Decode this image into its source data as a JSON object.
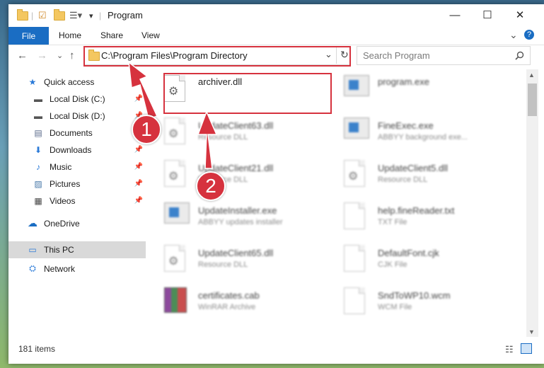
{
  "window": {
    "title": "Program",
    "controls": {
      "minimize": "—",
      "maximize": "☐",
      "close": "✕"
    }
  },
  "ribbon": {
    "tabs": [
      "File",
      "Home",
      "Share",
      "View"
    ],
    "expand": "⌄",
    "help": "?"
  },
  "nav": {
    "back": "←",
    "forward": "→",
    "recent": "⌄",
    "up": "↑",
    "address": "C:\\Program Files\\Program Directory",
    "address_dropdown": "⌄",
    "refresh": "↻",
    "search_placeholder": "Search Program",
    "search_icon": "search-icon"
  },
  "sidebar": {
    "items": [
      {
        "label": "Quick access",
        "icon": "★"
      },
      {
        "label": "Local Disk (C:)",
        "icon": "▬"
      },
      {
        "label": "Local Disk (D:)",
        "icon": "▬"
      },
      {
        "label": "Documents",
        "icon": "▤"
      },
      {
        "label": "Downloads",
        "icon": "⬇"
      },
      {
        "label": "Music",
        "icon": "♪"
      },
      {
        "label": "Pictures",
        "icon": "▨"
      },
      {
        "label": "Videos",
        "icon": "▦"
      },
      {
        "label": "OneDrive",
        "icon": "☁"
      },
      {
        "label": "This PC",
        "icon": "▭"
      },
      {
        "label": "Network",
        "icon": "⛭"
      }
    ],
    "pin": "📌"
  },
  "files": [
    {
      "name": "archiver.dll",
      "type": ""
    },
    {
      "name": "program.exe",
      "type": ""
    },
    {
      "name": "UpdateClient63.dll",
      "type": "Resource DLL"
    },
    {
      "name": "FineExec.exe",
      "type": "ABBYY background exe..."
    },
    {
      "name": "UpdateClient21.dll",
      "type": "Resource DLL"
    },
    {
      "name": "UpdateClient5.dll",
      "type": "Resource DLL"
    },
    {
      "name": "UpdateInstaller.exe",
      "type": "ABBYY updates installer"
    },
    {
      "name": "help.fineReader.txt",
      "type": "TXT File"
    },
    {
      "name": "UpdateClient65.dll",
      "type": "Resource DLL"
    },
    {
      "name": "DefaultFont.cjk",
      "type": "CJK File"
    },
    {
      "name": "certificates.cab",
      "type": "WinRAR Archive"
    },
    {
      "name": "SndToWP10.wcm",
      "type": "WCM File"
    }
  ],
  "status": {
    "count": "181 items"
  },
  "annotations": {
    "badge1": "1",
    "badge2": "2",
    "color": "#d6323e"
  }
}
